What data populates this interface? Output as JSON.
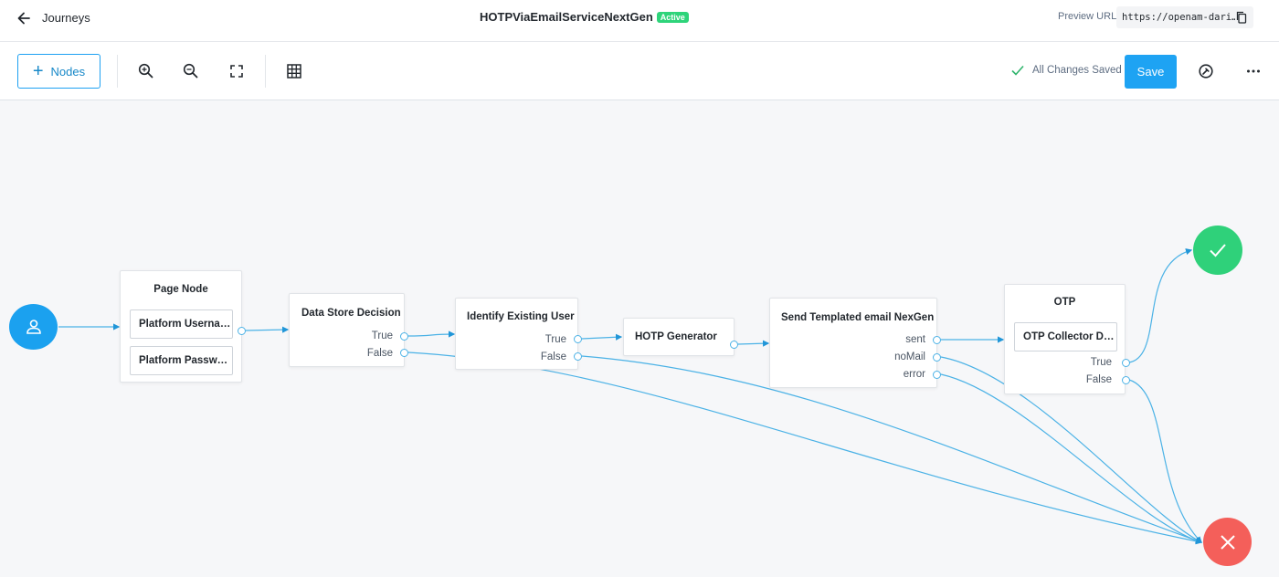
{
  "header": {
    "back_label": "Journeys",
    "title": "HOTPViaEmailServiceNextGen",
    "status_badge": "Active",
    "preview_label": "Preview URL:",
    "preview_url": "https://openam-dari…"
  },
  "toolbar": {
    "nodes_label": "Nodes",
    "saved_status": "All Changes Saved",
    "save_label": "Save"
  },
  "nodes": {
    "page_node": {
      "title": "Page Node",
      "children": [
        "Platform Userna…",
        "Platform Passw…"
      ]
    },
    "data_store_decision": {
      "title": "Data Store Decision",
      "outcomes": [
        "True",
        "False"
      ]
    },
    "identify_existing_user": {
      "title": "Identify Existing User",
      "outcomes": [
        "True",
        "False"
      ]
    },
    "hotp_generator": {
      "title": "HOTP Generator"
    },
    "send_templated_email": {
      "title": "Send Templated email NexGen",
      "outcomes": [
        "sent",
        "noMail",
        "error"
      ]
    },
    "otp": {
      "title": "OTP",
      "children": [
        "OTP Collector D…"
      ],
      "outcomes": [
        "True",
        "False"
      ]
    }
  },
  "colors": {
    "accent": "#1ea3f3",
    "success": "#2fd17a",
    "failure": "#f45f5a",
    "wire": "#4bb2e6",
    "badge": "#2ed47a"
  },
  "icons": [
    "back-arrow-icon",
    "copy-icon",
    "plus-icon",
    "zoom-in-icon",
    "zoom-out-icon",
    "fit-screen-icon",
    "grid-icon",
    "check-icon",
    "debug-icon",
    "more-icon",
    "person-icon",
    "success-check-icon",
    "failure-x-icon"
  ]
}
